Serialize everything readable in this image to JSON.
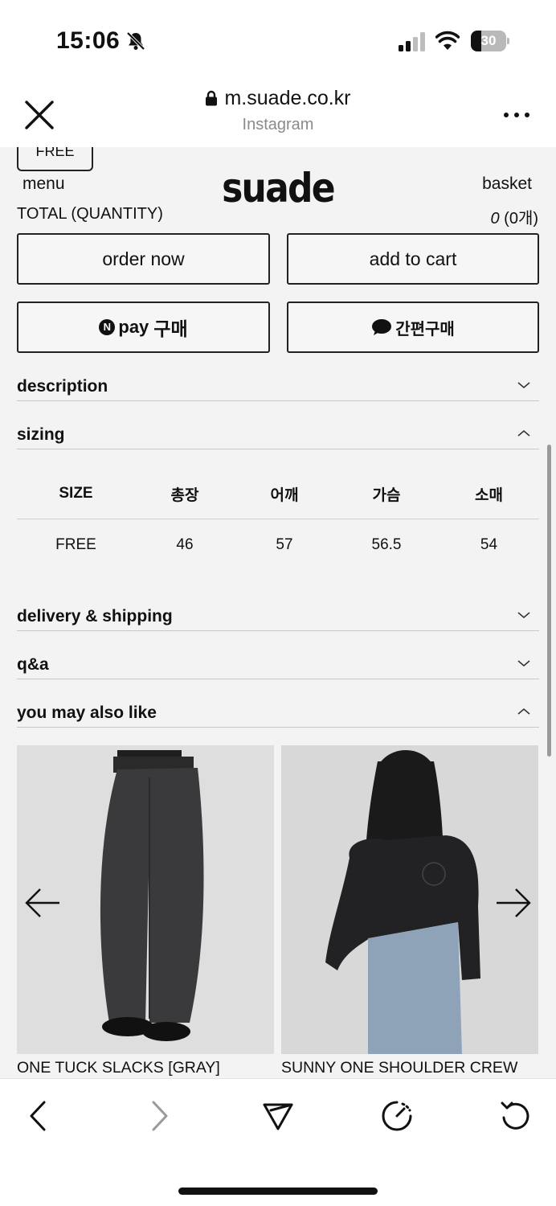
{
  "status_bar": {
    "time": "15:06",
    "battery_level": "30",
    "battery_fraction": 0.3
  },
  "browser": {
    "url": "m.suade.co.kr",
    "subtitle": "Instagram"
  },
  "header": {
    "size_chip": "FREE",
    "menu_label": "menu",
    "logo_text": "suade",
    "basket_label": "basket",
    "total_label": "TOTAL (QUANTITY)",
    "total_amount": "0",
    "total_quantity": "(0개)"
  },
  "buttons": {
    "order_now": "order now",
    "add_to_cart": "add to cart",
    "npay_badge": "N",
    "npay_label": "pay",
    "npay_suffix": "구매",
    "quick_buy": "간편구매"
  },
  "sections": {
    "description": "description",
    "sizing": "sizing",
    "delivery": "delivery & shipping",
    "qa": "q&a",
    "recommend": "you may also like"
  },
  "size_table": {
    "headers": [
      "SIZE",
      "총장",
      "어깨",
      "가슴",
      "소매"
    ],
    "rows": [
      [
        "FREE",
        "46",
        "57",
        "56.5",
        "54"
      ]
    ]
  },
  "products": [
    {
      "name": "ONE TUCK SLACKS [GRAY]"
    },
    {
      "name": "SUNNY ONE SHOULDER CREW"
    }
  ],
  "icons": {
    "muted": "bell-slash-icon",
    "close": "close-icon",
    "lock": "lock-icon",
    "more": "more-icon",
    "back": "chevron-left-icon",
    "forward": "chevron-right-icon",
    "share": "send-icon",
    "speed": "gauge-icon",
    "reload": "reload-icon"
  }
}
